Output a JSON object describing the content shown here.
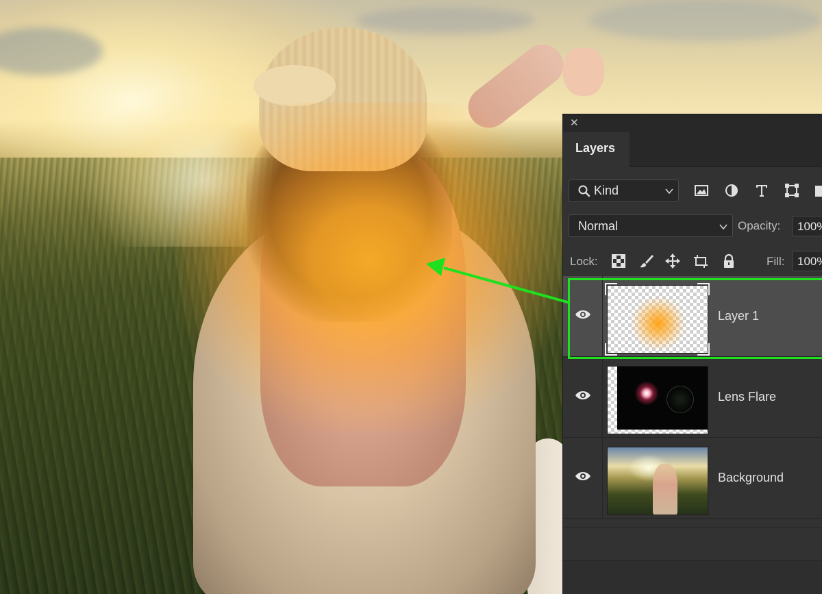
{
  "panel": {
    "tab_label": "Layers",
    "filter": {
      "kind_label": "Kind",
      "icons": [
        "image-filter-icon",
        "adjustment-filter-icon",
        "type-filter-icon",
        "shape-filter-icon",
        "smart-object-filter-icon"
      ]
    },
    "blend_mode": "Normal",
    "opacity_label": "Opacity:",
    "opacity_value": "100%",
    "lock_label": "Lock:",
    "lock_icons": [
      "lock-transparent-pixels-icon",
      "lock-image-pixels-icon",
      "lock-position-icon",
      "lock-artboard-icon",
      "lock-all-icon"
    ],
    "fill_label": "Fill:",
    "fill_value": "100%"
  },
  "layers": [
    {
      "name": "Layer 1",
      "visible": true,
      "selected": true,
      "thumbnail": "orange-glow-on-transparent"
    },
    {
      "name": "Lens Flare",
      "visible": true,
      "selected": false,
      "thumbnail": "lens-flare-on-black"
    },
    {
      "name": "Background",
      "visible": true,
      "selected": false,
      "thumbnail": "photo"
    }
  ],
  "colors": {
    "panel_bg": "#323232",
    "selected_row": "#4d4d4d",
    "highlight_green": "#1fe01f",
    "glow_orange": "#ffb028"
  }
}
